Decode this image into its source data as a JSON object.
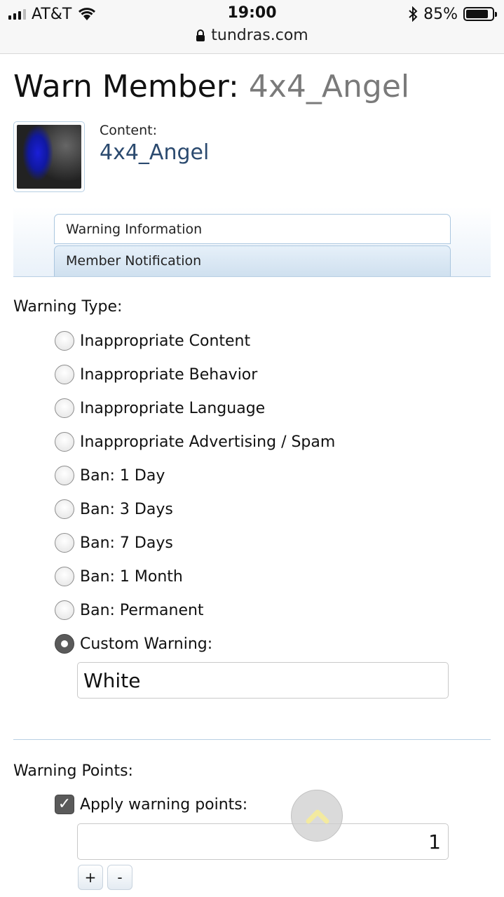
{
  "status_bar": {
    "carrier": "AT&T",
    "time": "19:00",
    "battery_percent": "85%",
    "battery_level": 0.85,
    "url": "tundras.com"
  },
  "header": {
    "title_prefix": "Warn Member:",
    "member_name": "4x4_Angel"
  },
  "content_info": {
    "label": "Content:",
    "name": "4x4_Angel"
  },
  "tabs": [
    {
      "label": "Warning Information"
    },
    {
      "label": "Member Notification"
    }
  ],
  "warning_type": {
    "label": "Warning Type:",
    "options": [
      {
        "label": "Inappropriate Content",
        "selected": false
      },
      {
        "label": "Inappropriate Behavior",
        "selected": false
      },
      {
        "label": "Inappropriate Language",
        "selected": false
      },
      {
        "label": "Inappropriate Advertising / Spam",
        "selected": false
      },
      {
        "label": "Ban: 1 Day",
        "selected": false
      },
      {
        "label": "Ban: 3 Days",
        "selected": false
      },
      {
        "label": "Ban: 7 Days",
        "selected": false
      },
      {
        "label": "Ban: 1 Month",
        "selected": false
      },
      {
        "label": "Ban: Permanent",
        "selected": false
      },
      {
        "label": "Custom Warning:",
        "selected": true
      }
    ],
    "custom_value": "White"
  },
  "warning_points": {
    "label": "Warning Points:",
    "apply_label": "Apply warning points:",
    "apply_checked": true,
    "points_value": "1",
    "increment_label": "+",
    "decrement_label": "-"
  },
  "icons": {
    "signal": "cellular-signal-icon",
    "wifi": "wifi-icon",
    "bluetooth": "bluetooth-icon",
    "battery": "battery-icon",
    "lock": "lock-icon",
    "scroll_top": "chevron-up-icon"
  },
  "colors": {
    "link": "#2b4a6f",
    "tab_border": "#aac6df",
    "muted_title": "#7a7a7a",
    "scroll_arrow": "#f3eaa0"
  }
}
